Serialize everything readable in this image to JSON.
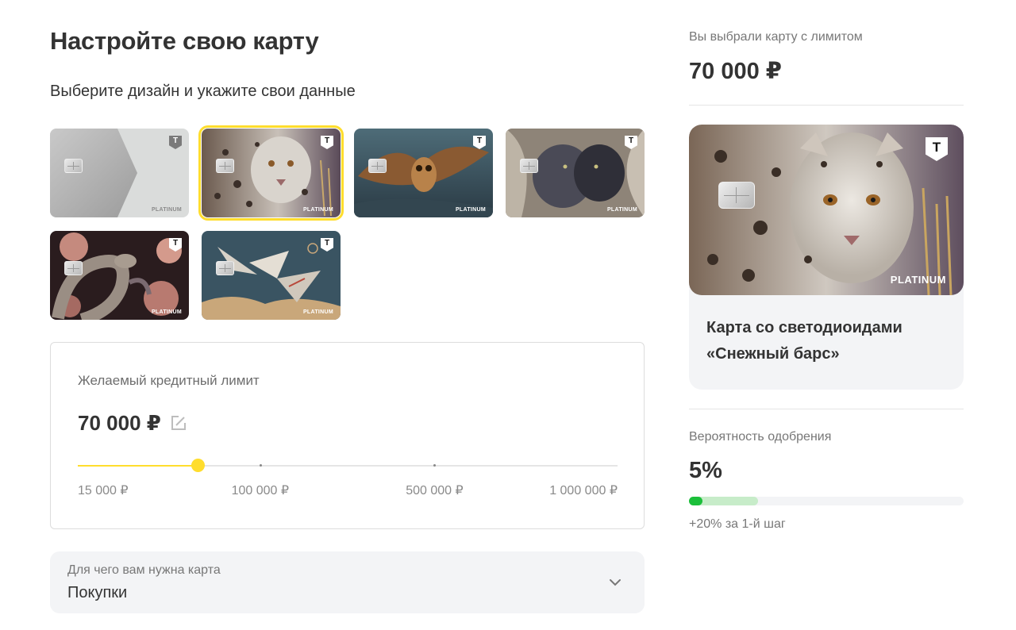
{
  "header": {
    "title": "Настройте свою карту",
    "subtitle": "Выберите дизайн и укажите свои данные"
  },
  "designs": {
    "selected_index": 1,
    "cards": [
      {
        "name": "platinum-silver",
        "platinum_label": "PLATINUM",
        "badge_letter": "Т"
      },
      {
        "name": "snow-leopard",
        "platinum_label": "PLATINUM",
        "badge_letter": "Т"
      },
      {
        "name": "owl",
        "platinum_label": "PLATINUM",
        "badge_letter": "Т"
      },
      {
        "name": "panthers",
        "platinum_label": "PLATINUM",
        "badge_letter": "Т"
      },
      {
        "name": "snake",
        "platinum_label": "PLATINUM",
        "badge_letter": "Т"
      },
      {
        "name": "cranes",
        "platinum_label": "PLATINUM",
        "badge_letter": "Т"
      }
    ]
  },
  "credit_limit": {
    "label": "Желаемый кредитный лимит",
    "value": "70 000 ₽",
    "slider_position": 0.222,
    "ticks": [
      {
        "label": "15 000 ₽",
        "position": 0.0
      },
      {
        "label": "100 000 ₽",
        "position": 0.338
      },
      {
        "label": "500 000 ₽",
        "position": 0.661
      },
      {
        "label": "1 000 000 ₽",
        "position": 1.0
      }
    ]
  },
  "purpose": {
    "label": "Для чего вам нужна карта",
    "value": "Покупки",
    "icon": "chevron-down-icon"
  },
  "summary": {
    "limit_label": "Вы выбрали карту с лимитом",
    "limit_value": "70 000 ₽",
    "card_badge_letter": "Т",
    "card_platinum_label": "PLATINUM",
    "card_title_line1": "Карта со светодиоидами",
    "card_title_line2": "«Снежный барс»"
  },
  "approval": {
    "label": "Вероятность одобрения",
    "value": "5%",
    "current_fraction": 0.05,
    "potential_fraction": 0.25,
    "hint": "+20% за 1-й шаг"
  },
  "colors": {
    "accent": "#ffdd2d",
    "approval_green": "#1bbf3a",
    "approval_light": "#c7ecc9",
    "panel_bg": "#f3f4f6"
  }
}
